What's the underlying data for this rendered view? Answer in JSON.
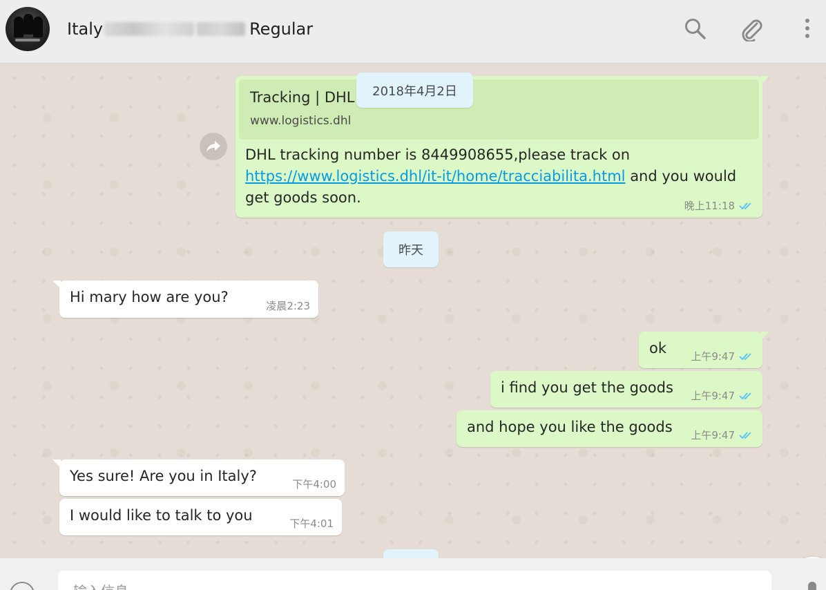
{
  "header": {
    "title_start": "Italy",
    "title_end": "Regular",
    "search_icon": "search-icon",
    "attach_icon": "paperclip-icon",
    "menu_icon": "more-vertical-icon"
  },
  "colors": {
    "outgoing_bubble": "#dcf8c6",
    "incoming_bubble": "#ffffff",
    "date_pill": "#e1f3fb",
    "link": "#039be5",
    "read_ticks": "#4fc3f7"
  },
  "date_pills": {
    "top": "2018年4月2日",
    "yesterday": "昨天"
  },
  "link_message": {
    "preview_title": "Tracking | DHL",
    "preview_url": "www.logistics.dhl",
    "text_before_link": "DHL tracking number is 8449908655,please track on",
    "link": "https://www.logistics.dhl/it-it/home/tracciabilita.html",
    "text_after_link": "and you would get goods soon.",
    "time": "晚上11:18"
  },
  "messages": [
    {
      "direction": "in",
      "text": "Hi mary how are you?",
      "time": "凌晨2:23"
    },
    {
      "direction": "out",
      "text": "ok",
      "time": "上午9:47"
    },
    {
      "direction": "out",
      "text": "i find you get the goods",
      "time": "上午9:47"
    },
    {
      "direction": "out",
      "text": "and hope you like the goods",
      "time": "上午9:47"
    },
    {
      "direction": "in",
      "text": "Yes sure! Are you in Italy?",
      "time": "下午4:00"
    },
    {
      "direction": "in",
      "text": "I would like to talk to you",
      "time": "下午4:01"
    }
  ],
  "composer": {
    "placeholder": "输入信息"
  }
}
